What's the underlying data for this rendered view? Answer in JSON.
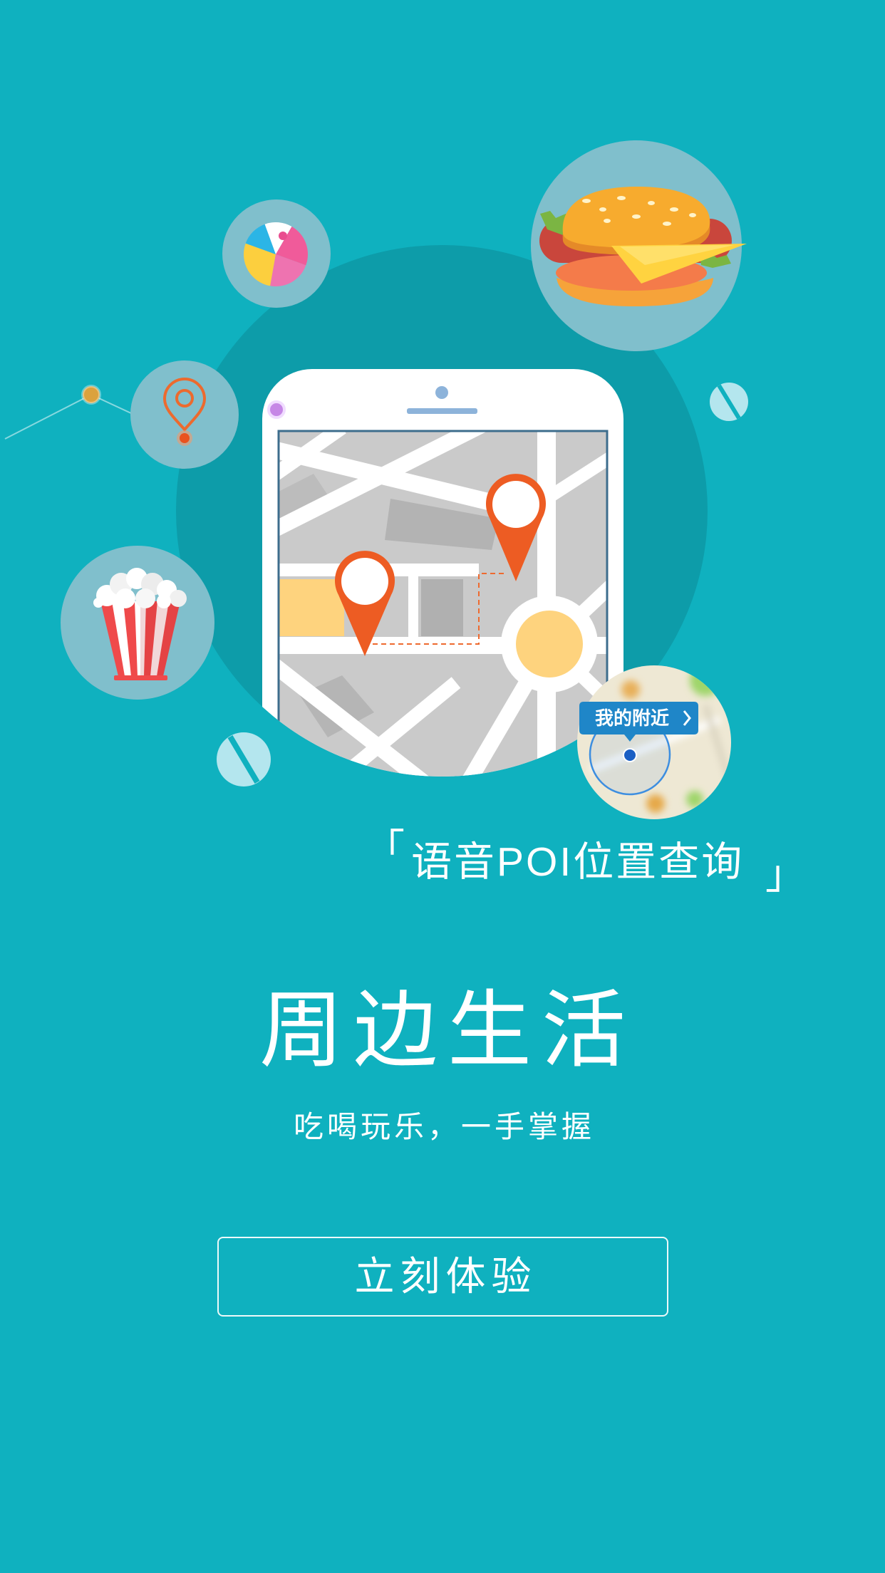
{
  "colors": {
    "background": "#0fb1bf",
    "backdrop_circle": "#0d9ca9",
    "bubble": "#80bfcc",
    "pin_orange": "#ed5c23",
    "map_yellow": "#fed37e",
    "tag_blue": "#1f86c8"
  },
  "illustration": {
    "icons": [
      "beach-ball-icon",
      "hamburger-icon",
      "location-pin-icon",
      "popcorn-icon",
      "pill-icon",
      "phone-map-icon",
      "chevron-right-icon"
    ],
    "nearby_label": "我的附近"
  },
  "feature": {
    "bracket_open": "「",
    "name": "语音POI位置查询",
    "bracket_close": "」"
  },
  "headline": "周边生活",
  "subtitle": "吃喝玩乐，一手掌握",
  "cta_button": "立刻体验"
}
